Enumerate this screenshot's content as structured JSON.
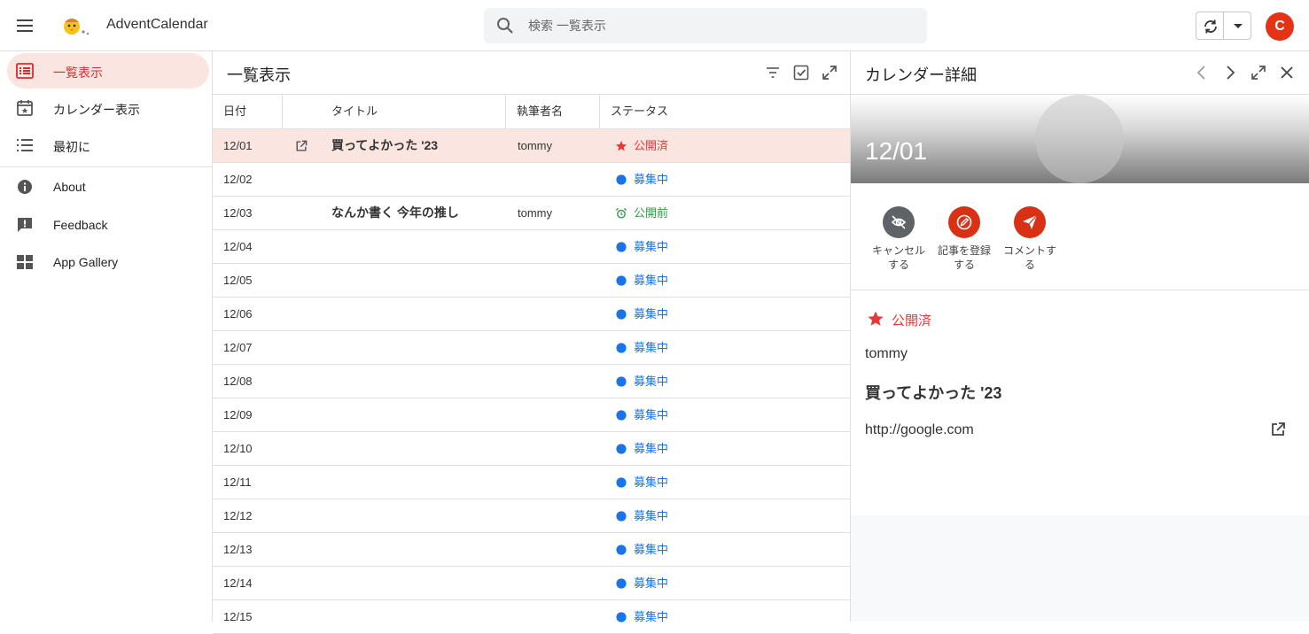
{
  "app": {
    "title": "AdventCalendar",
    "avatar_letter": "C",
    "accent": "#e53316"
  },
  "search": {
    "placeholder": "検索 一覧表示"
  },
  "sidebar": {
    "items": [
      {
        "label": "一覧表示",
        "icon": "list-view-icon",
        "active": true
      },
      {
        "label": "カレンダー表示",
        "icon": "calendar-icon"
      },
      {
        "label": "最初に",
        "icon": "bullet-list-icon"
      },
      {
        "label": "About",
        "icon": "info-icon"
      },
      {
        "label": "Feedback",
        "icon": "feedback-icon"
      },
      {
        "label": "App Gallery",
        "icon": "grid-icon"
      }
    ]
  },
  "list": {
    "title": "一覧表示",
    "columns": {
      "date": "日付",
      "title": "タイトル",
      "author": "執筆者名",
      "status": "ステータス"
    },
    "rows": [
      {
        "date": "12/01",
        "title": "買ってよかった '23",
        "author": "tommy",
        "status": "公開済",
        "status_type": "published",
        "has_link": true,
        "selected": true
      },
      {
        "date": "12/02",
        "title": "",
        "author": "",
        "status": "募集中",
        "status_type": "open"
      },
      {
        "date": "12/03",
        "title": "なんか書く 今年の推し",
        "author": "tommy",
        "status": "公開前",
        "status_type": "scheduled"
      },
      {
        "date": "12/04",
        "title": "",
        "author": "",
        "status": "募集中",
        "status_type": "open"
      },
      {
        "date": "12/05",
        "title": "",
        "author": "",
        "status": "募集中",
        "status_type": "open"
      },
      {
        "date": "12/06",
        "title": "",
        "author": "",
        "status": "募集中",
        "status_type": "open"
      },
      {
        "date": "12/07",
        "title": "",
        "author": "",
        "status": "募集中",
        "status_type": "open"
      },
      {
        "date": "12/08",
        "title": "",
        "author": "",
        "status": "募集中",
        "status_type": "open"
      },
      {
        "date": "12/09",
        "title": "",
        "author": "",
        "status": "募集中",
        "status_type": "open"
      },
      {
        "date": "12/10",
        "title": "",
        "author": "",
        "status": "募集中",
        "status_type": "open"
      },
      {
        "date": "12/11",
        "title": "",
        "author": "",
        "status": "募集中",
        "status_type": "open"
      },
      {
        "date": "12/12",
        "title": "",
        "author": "",
        "status": "募集中",
        "status_type": "open"
      },
      {
        "date": "12/13",
        "title": "",
        "author": "",
        "status": "募集中",
        "status_type": "open"
      },
      {
        "date": "12/14",
        "title": "",
        "author": "",
        "status": "募集中",
        "status_type": "open"
      },
      {
        "date": "12/15",
        "title": "",
        "author": "",
        "status": "募集中",
        "status_type": "open"
      }
    ],
    "status_colors": {
      "published": "#e53935",
      "open": "#1a73e8",
      "scheduled": "#2e9e44"
    }
  },
  "detail": {
    "title": "カレンダー詳細",
    "date": "12/01",
    "actions": [
      {
        "label": "キャンセルする",
        "icon": "cancel-icon",
        "color": "#5f6368"
      },
      {
        "label": "記事を登録する",
        "icon": "register-icon",
        "color": "#d93116"
      },
      {
        "label": "コメントする",
        "icon": "send-icon",
        "color": "#d93116"
      }
    ],
    "status": "公開済",
    "author": "tommy",
    "post_title": "買ってよかった '23",
    "url": "http://google.com"
  }
}
